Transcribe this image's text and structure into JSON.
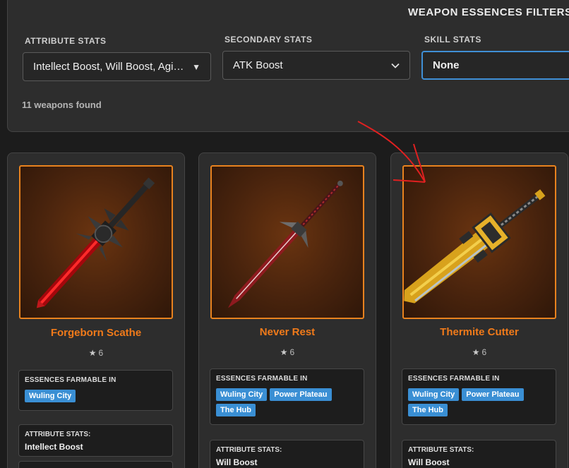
{
  "filters": {
    "title": "WEAPON ESSENCES FILTERS",
    "attribute": {
      "label": "ATTRIBUTE STATS",
      "value": "Intellect Boost, Will Boost, Agi…",
      "caret": "▼"
    },
    "secondary": {
      "label": "SECONDARY STATS",
      "value": "ATK Boost",
      "caret": "⌄"
    },
    "skill": {
      "label": "SKILL STATS",
      "value": "None"
    },
    "results": "11 weapons found"
  },
  "cards": [
    {
      "name": "Forgeborn Scathe",
      "rarity": "6",
      "farm_title": "ESSENCES FARMABLE IN",
      "locations": [
        "Wuling City"
      ],
      "attr_title": "ATTRIBUTE STATS:",
      "attr_value": "Intellect Boost"
    },
    {
      "name": "Never Rest",
      "rarity": "6",
      "farm_title": "ESSENCES FARMABLE IN",
      "locations": [
        "Wuling City",
        "Power Plateau",
        "The Hub"
      ],
      "attr_title": "ATTRIBUTE STATS:",
      "attr_value": "Will Boost"
    },
    {
      "name": "Thermite Cutter",
      "rarity": "6",
      "farm_title": "ESSENCES FARMABLE IN",
      "locations": [
        "Wuling City",
        "Power Plateau",
        "The Hub"
      ],
      "attr_title": "ATTRIBUTE STATS:",
      "attr_value": "Will Boost"
    }
  ],
  "colors": {
    "accent": "#f07a1a",
    "chip": "#3a8fd4",
    "annotation": "#e02020"
  }
}
